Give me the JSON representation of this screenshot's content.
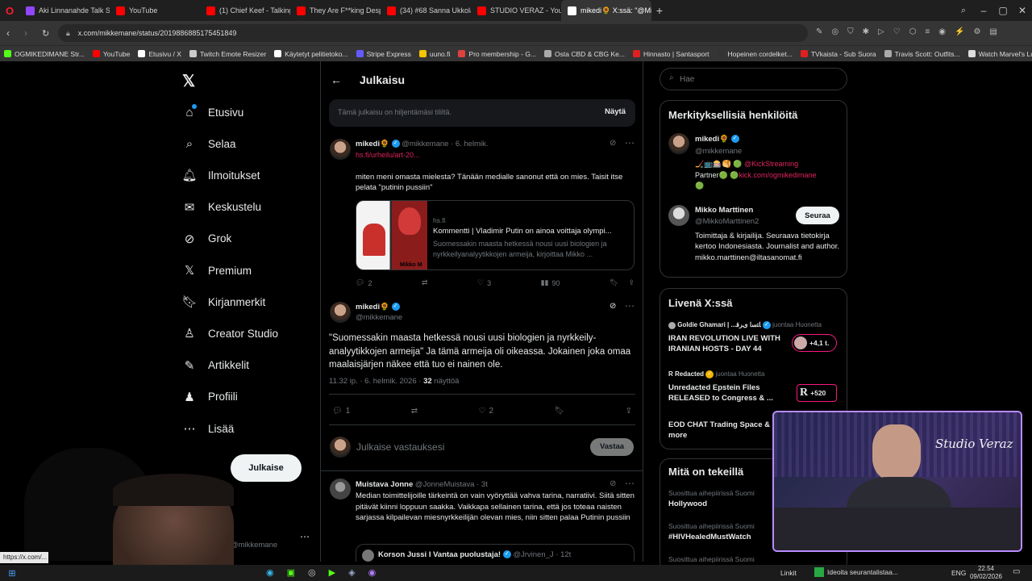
{
  "browser": {
    "tabs": [
      {
        "label": "Aki Linnanahde Talk Show",
        "color": "#9146ff"
      },
      {
        "label": "YouTube",
        "color": "#ff0000"
      },
      {
        "label": "(1) Chief Keef - Talking In",
        "color": "#ff0000"
      },
      {
        "label": "They Are F**king Desperat",
        "color": "#ff0000"
      },
      {
        "label": "(34) #68 Sanna Ukkola - Yo",
        "color": "#ff0000"
      },
      {
        "label": "STUDIO VERAZ - YouT",
        "color": "#ff0000"
      },
      {
        "label": "mikedi🌻 X:ssä: \"@Mikko",
        "color": "#ffffff"
      }
    ],
    "url": "x.com/mikkemane/status/2019886885175451849",
    "bookmarks": [
      {
        "label": "OGMIKEDIMANE Str...",
        "color": "#53fc18"
      },
      {
        "label": "YouTube",
        "color": "#ff0000"
      },
      {
        "label": "Etusivu / X",
        "color": "#ffffff"
      },
      {
        "label": "Twitch Emote Resizer",
        "color": "#cccccc"
      },
      {
        "label": "Käytetyt pelitietoko...",
        "color": "#ffffff"
      },
      {
        "label": "Stripe Express",
        "color": "#635bff"
      },
      {
        "label": "uuno.fi",
        "color": "#f5c400"
      },
      {
        "label": "Pro membership - G...",
        "color": "#e04040"
      },
      {
        "label": "Osta CBD & CBG Ke...",
        "color": "#aaaaaa"
      },
      {
        "label": "Hinnasto | Santasport",
        "color": "#e02020"
      },
      {
        "label": "Hopeinen cordelket...",
        "color": "#333333"
      },
      {
        "label": "TVkaista - Sub Suora",
        "color": "#e02020"
      },
      {
        "label": "Travis Scott: Outfits...",
        "color": "#aaaaaa"
      },
      {
        "label": "Watch Marvel's Luk...",
        "color": "#dddddd"
      }
    ]
  },
  "nav": {
    "items": [
      {
        "label": "Etusivu",
        "icon": "home-icon"
      },
      {
        "label": "Selaa",
        "icon": "search-icon"
      },
      {
        "label": "Ilmoitukset",
        "icon": "bell-icon"
      },
      {
        "label": "Keskustelu",
        "icon": "envelope-icon"
      },
      {
        "label": "Grok",
        "icon": "grok-icon"
      },
      {
        "label": "Premium",
        "icon": "x-icon"
      },
      {
        "label": "Kirjanmerkit",
        "icon": "bookmark-icon"
      },
      {
        "label": "Creator Studio",
        "icon": "creator-icon"
      },
      {
        "label": "Artikkelit",
        "icon": "article-icon"
      },
      {
        "label": "Profiili",
        "icon": "person-icon"
      },
      {
        "label": "Lisää",
        "icon": "more-icon"
      }
    ],
    "post_button": "Julkaise",
    "account_handle": "@mikkemane"
  },
  "header": {
    "title": "Julkaisu"
  },
  "hidden_notice": {
    "text": "Tämä julkaisu on hiljentämäsi tililtä.",
    "button": "Näytä"
  },
  "quoted_post": {
    "name": "mikedi🌻",
    "handle": "@mikkemane",
    "date": "· 6. helmik.",
    "link": "hs.fi/urheilu/art-20...",
    "text": "miten meni omasta mielesta? Tänään medialle sanonut että on mies. Taisit itse pelata \"putinin pussiin\"",
    "card_domain": "hs.fi",
    "card_title": "Kommentti | Vladimir Putin on ainoa voittaja olympi...",
    "card_desc": "Suomessakin maasta hetkessä nousi uusi biologien ja nyrkkeilyanalyytikkojen armeija, kirjoittaa Mikko ...",
    "card_image_caption": "Mikko M",
    "replies": "2",
    "likes": "3",
    "views": "90"
  },
  "main_post": {
    "name": "mikedi🌻",
    "handle": "@mikkemane",
    "text": "\"Suomessakin maasta hetkessä nousi uusi biologien ja nyrkkeily-analyytikkojen armeija\" Ja tämä armeija oli oikeassa. Jokainen joka omaa maalaisjärjen näkee että tuo ei nainen ole.",
    "timestamp": "11.32 ip. · 6. helmik. 2026 ·",
    "views_count": "32",
    "views_label": "näyttöä",
    "replies": "1",
    "likes": "2"
  },
  "reply_box": {
    "placeholder": "Julkaise vastauksesi",
    "button": "Vastaa"
  },
  "reply_post": {
    "name": "Muistava Jonne",
    "handle": "@JonneMuistava",
    "date": "· 3t",
    "text": "Median toimittelijoille tärkeintä on vain vyöryttää vahva tarina, narratiivi. Siitä sitten pitävät kiinni loppuun saakka. Vaikkapa sellainen tarina, että jos toteaa naisten sarjassa kilpailevan miesnyrkkeilijän olevan mies, niin sitten palaa Putinin pussiin",
    "quote_name": "Korson Jussi I Vantaa puolustaja!",
    "quote_handle": "@Jrvinen_J",
    "quote_date": "· 12t"
  },
  "search": {
    "placeholder": "Hae"
  },
  "relevant_people": {
    "title": "Merkityksellisiä henkilöitä",
    "people": [
      {
        "name": "mikedi🌻",
        "handle": "@mikkemane",
        "bio_1": "🏒📺🎰🥞 🟢 ",
        "bio_link_1": "@KickStreaming",
        "bio_2": "Partner🟢 🟢",
        "bio_link_2": "kick.com/ogmikedimane",
        "bio_3": "🟢"
      },
      {
        "name": "Mikko Marttinen",
        "handle": "@MikkoMarttinen2",
        "follow": "Seuraa",
        "bio": "Toimittaja & kirjailija. Seuraava tietokirja kertoo Indonesiasta. Journalist and author. mikko.marttinen@iltasanomat.fi"
      }
    ]
  },
  "live": {
    "title": "Livenä X:ssä",
    "items": [
      {
        "host": "Goldie Ghamari | ...ﺎﺘﺳﺍ ﻯﺮﻗ",
        "status": "juontaa Huonetta",
        "title": "IRAN REVOLUTION LIVE WITH IRANIAN HOSTS - DAY 44",
        "count": "+4,1 t."
      },
      {
        "host": "Redacted",
        "status": "juontaa Huonetta",
        "title": "Unredacted Epstein Files RELEASED to Congress & ...",
        "count": "+520"
      },
      {
        "title": "EOD CHAT Trading Space & more"
      }
    ]
  },
  "trends": {
    "title": "Mitä on tekeillä",
    "items": [
      {
        "context": "Suosittua aihepiirissä Suomi",
        "name": "Hollywood"
      },
      {
        "context": "Suosittua aihepiirissä Suomi",
        "name": "#HIVHealedMustWatch"
      },
      {
        "context": "Suosittua aihepiirissä Suomi",
        "name": ""
      }
    ]
  },
  "overlay": {
    "watermark": "Studio Veraz",
    "status_url": "https://x.com/..."
  },
  "taskbar": {
    "links": "Linkit",
    "notification": "Ideoita seurantalistaa...",
    "lang": "ENG",
    "time": "22.54",
    "date": "09/02/2026"
  }
}
